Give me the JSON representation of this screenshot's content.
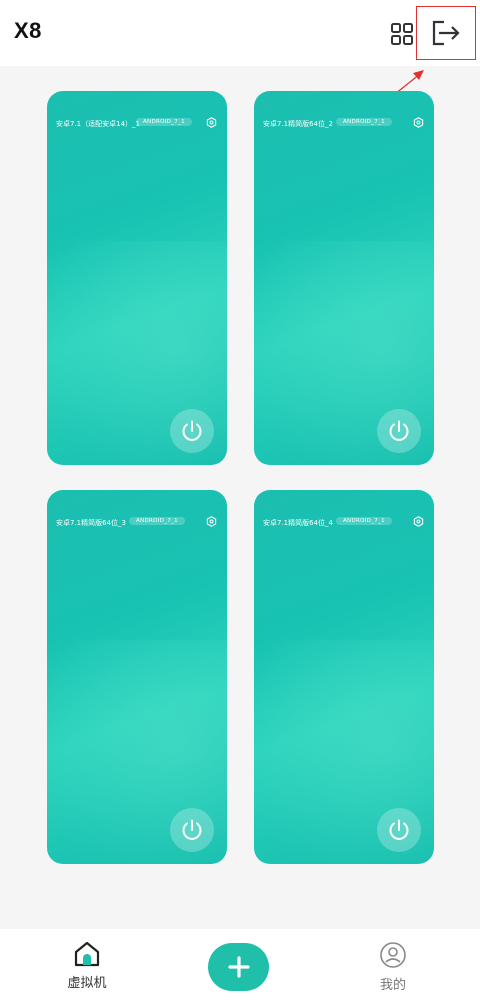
{
  "header": {
    "title": "X8",
    "grid_icon": "grid-icon",
    "exit_icon": "exit-icon"
  },
  "devices": [
    {
      "name": "安卓7.1（适配安卓14）_1",
      "badge": "ANDROID_7_1"
    },
    {
      "name": "安卓7.1精简版64位_2",
      "badge": "ANDROID_7_1"
    },
    {
      "name": "安卓7.1精简版64位_3",
      "badge": "ANDROID_7_1"
    },
    {
      "name": "安卓7.1精简版64位_4",
      "badge": "ANDROID_7_1"
    }
  ],
  "bottom_nav": {
    "home_label": "虚拟机",
    "mine_label": "我的"
  },
  "colors": {
    "accent": "#1fbfaa",
    "card": "#1cc2b2",
    "annotation": "#e03131"
  }
}
